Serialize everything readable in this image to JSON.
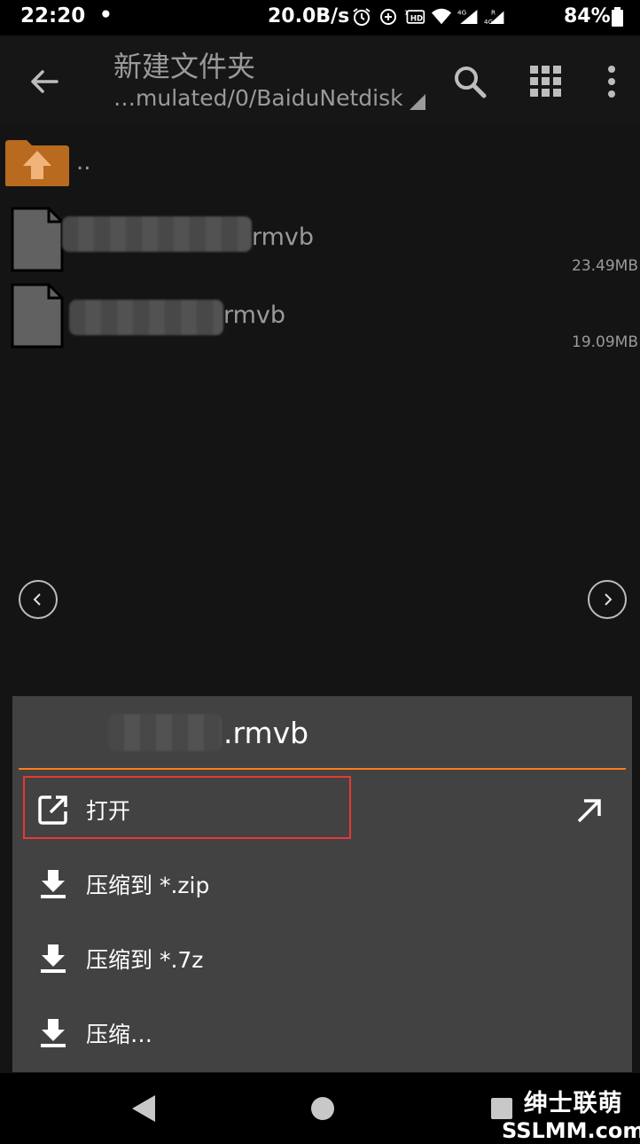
{
  "status_bar": {
    "time": "22:20",
    "dot": "•",
    "network_speed": "20.0B/s",
    "battery_percent": "84%",
    "icons": [
      "alarm-icon",
      "data-saver-icon",
      "hd-icon",
      "wifi-icon",
      "signal-4g-icon",
      "signal-4g-roaming-icon",
      "battery-icon"
    ]
  },
  "app_bar": {
    "title": "新建文件夹",
    "path": "…mulated/0/BaiduNetdisk"
  },
  "file_list": {
    "parent_label": "..",
    "files": [
      {
        "name_suffix": "rmvb",
        "size": "23.49MB"
      },
      {
        "name_suffix": "rmvb",
        "size": "19.09MB"
      }
    ]
  },
  "dialog": {
    "title_suffix": ".rmvb",
    "accent_color": "#ff7b1a",
    "items": [
      {
        "label": "打开",
        "icon": "open-external-icon"
      },
      {
        "label": "压缩到 *.zip",
        "icon": "download-icon"
      },
      {
        "label": "压缩到 *.7z",
        "icon": "download-icon"
      },
      {
        "label": "压缩…",
        "icon": "download-icon"
      }
    ]
  },
  "watermark": {
    "line1": "绅士联萌",
    "line2": "SSLMM.com"
  }
}
